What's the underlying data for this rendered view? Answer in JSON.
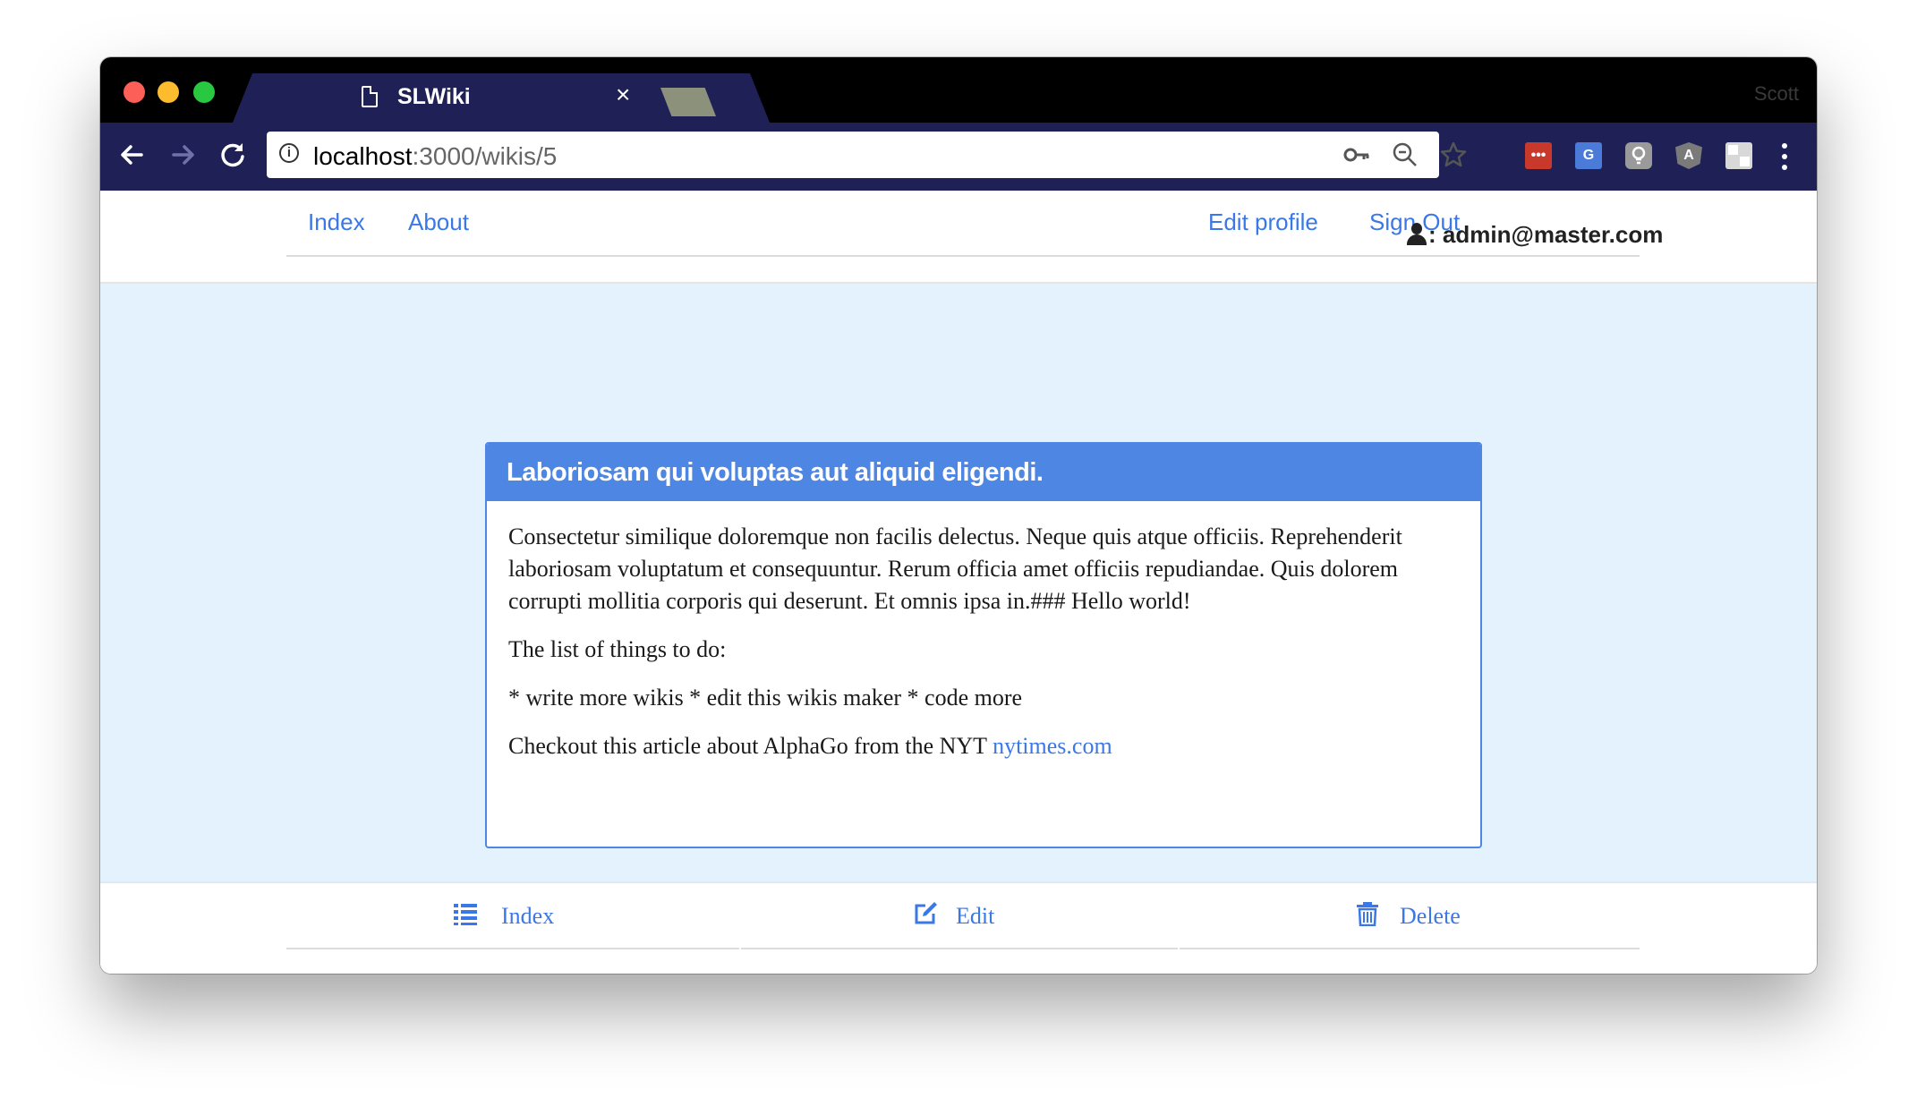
{
  "browser": {
    "tab_title": "SLWiki",
    "tab_close": "×",
    "profile_name": "Scott",
    "url_host": "localhost",
    "url_rest": ":3000/wikis/5",
    "info_glyph": "i",
    "icons": {
      "back": "back-arrow-icon",
      "forward": "forward-arrow-icon",
      "reload": "reload-icon",
      "key": "key-icon",
      "zoom": "zoom-out-icon",
      "star": "bookmark-star-icon"
    },
    "extensions": [
      "lastpass-extension-icon",
      "google-translate-extension-icon",
      "lightbulb-extension-icon",
      "angular-extension-icon",
      "puzzle-extension-icon"
    ]
  },
  "nav": {
    "index": "Index",
    "about": "About",
    "edit_profile": "Edit profile",
    "sign_out": "Sign Out",
    "user_separator": ":",
    "user_email": "admin@master.com"
  },
  "wiki": {
    "title": "Laboriosam qui voluptas aut aliquid eligendi.",
    "paragraph1": "Consectetur similique doloremque non facilis delectus. Neque quis atque officiis. Reprehenderit laboriosam voluptatum et consequuntur. Rerum officia amet officiis repudiandae. Quis dolorem corrupti mollitia corporis qui deserunt. Et omnis ipsa in.### Hello world!",
    "paragraph2": "The list of things to do:",
    "paragraph3": "* write more wikis * edit this wikis maker * code more",
    "paragraph4_text": "Checkout this article about AlphaGo from the NYT",
    "paragraph4_link": "nytimes.com"
  },
  "footer": {
    "index": "Index",
    "edit": "Edit",
    "delete": "Delete"
  },
  "colors": {
    "accent": "#4e86e4",
    "link": "#3b78e7",
    "page_bg": "#e3f2fd",
    "browser_chrome": "#1f2156"
  }
}
